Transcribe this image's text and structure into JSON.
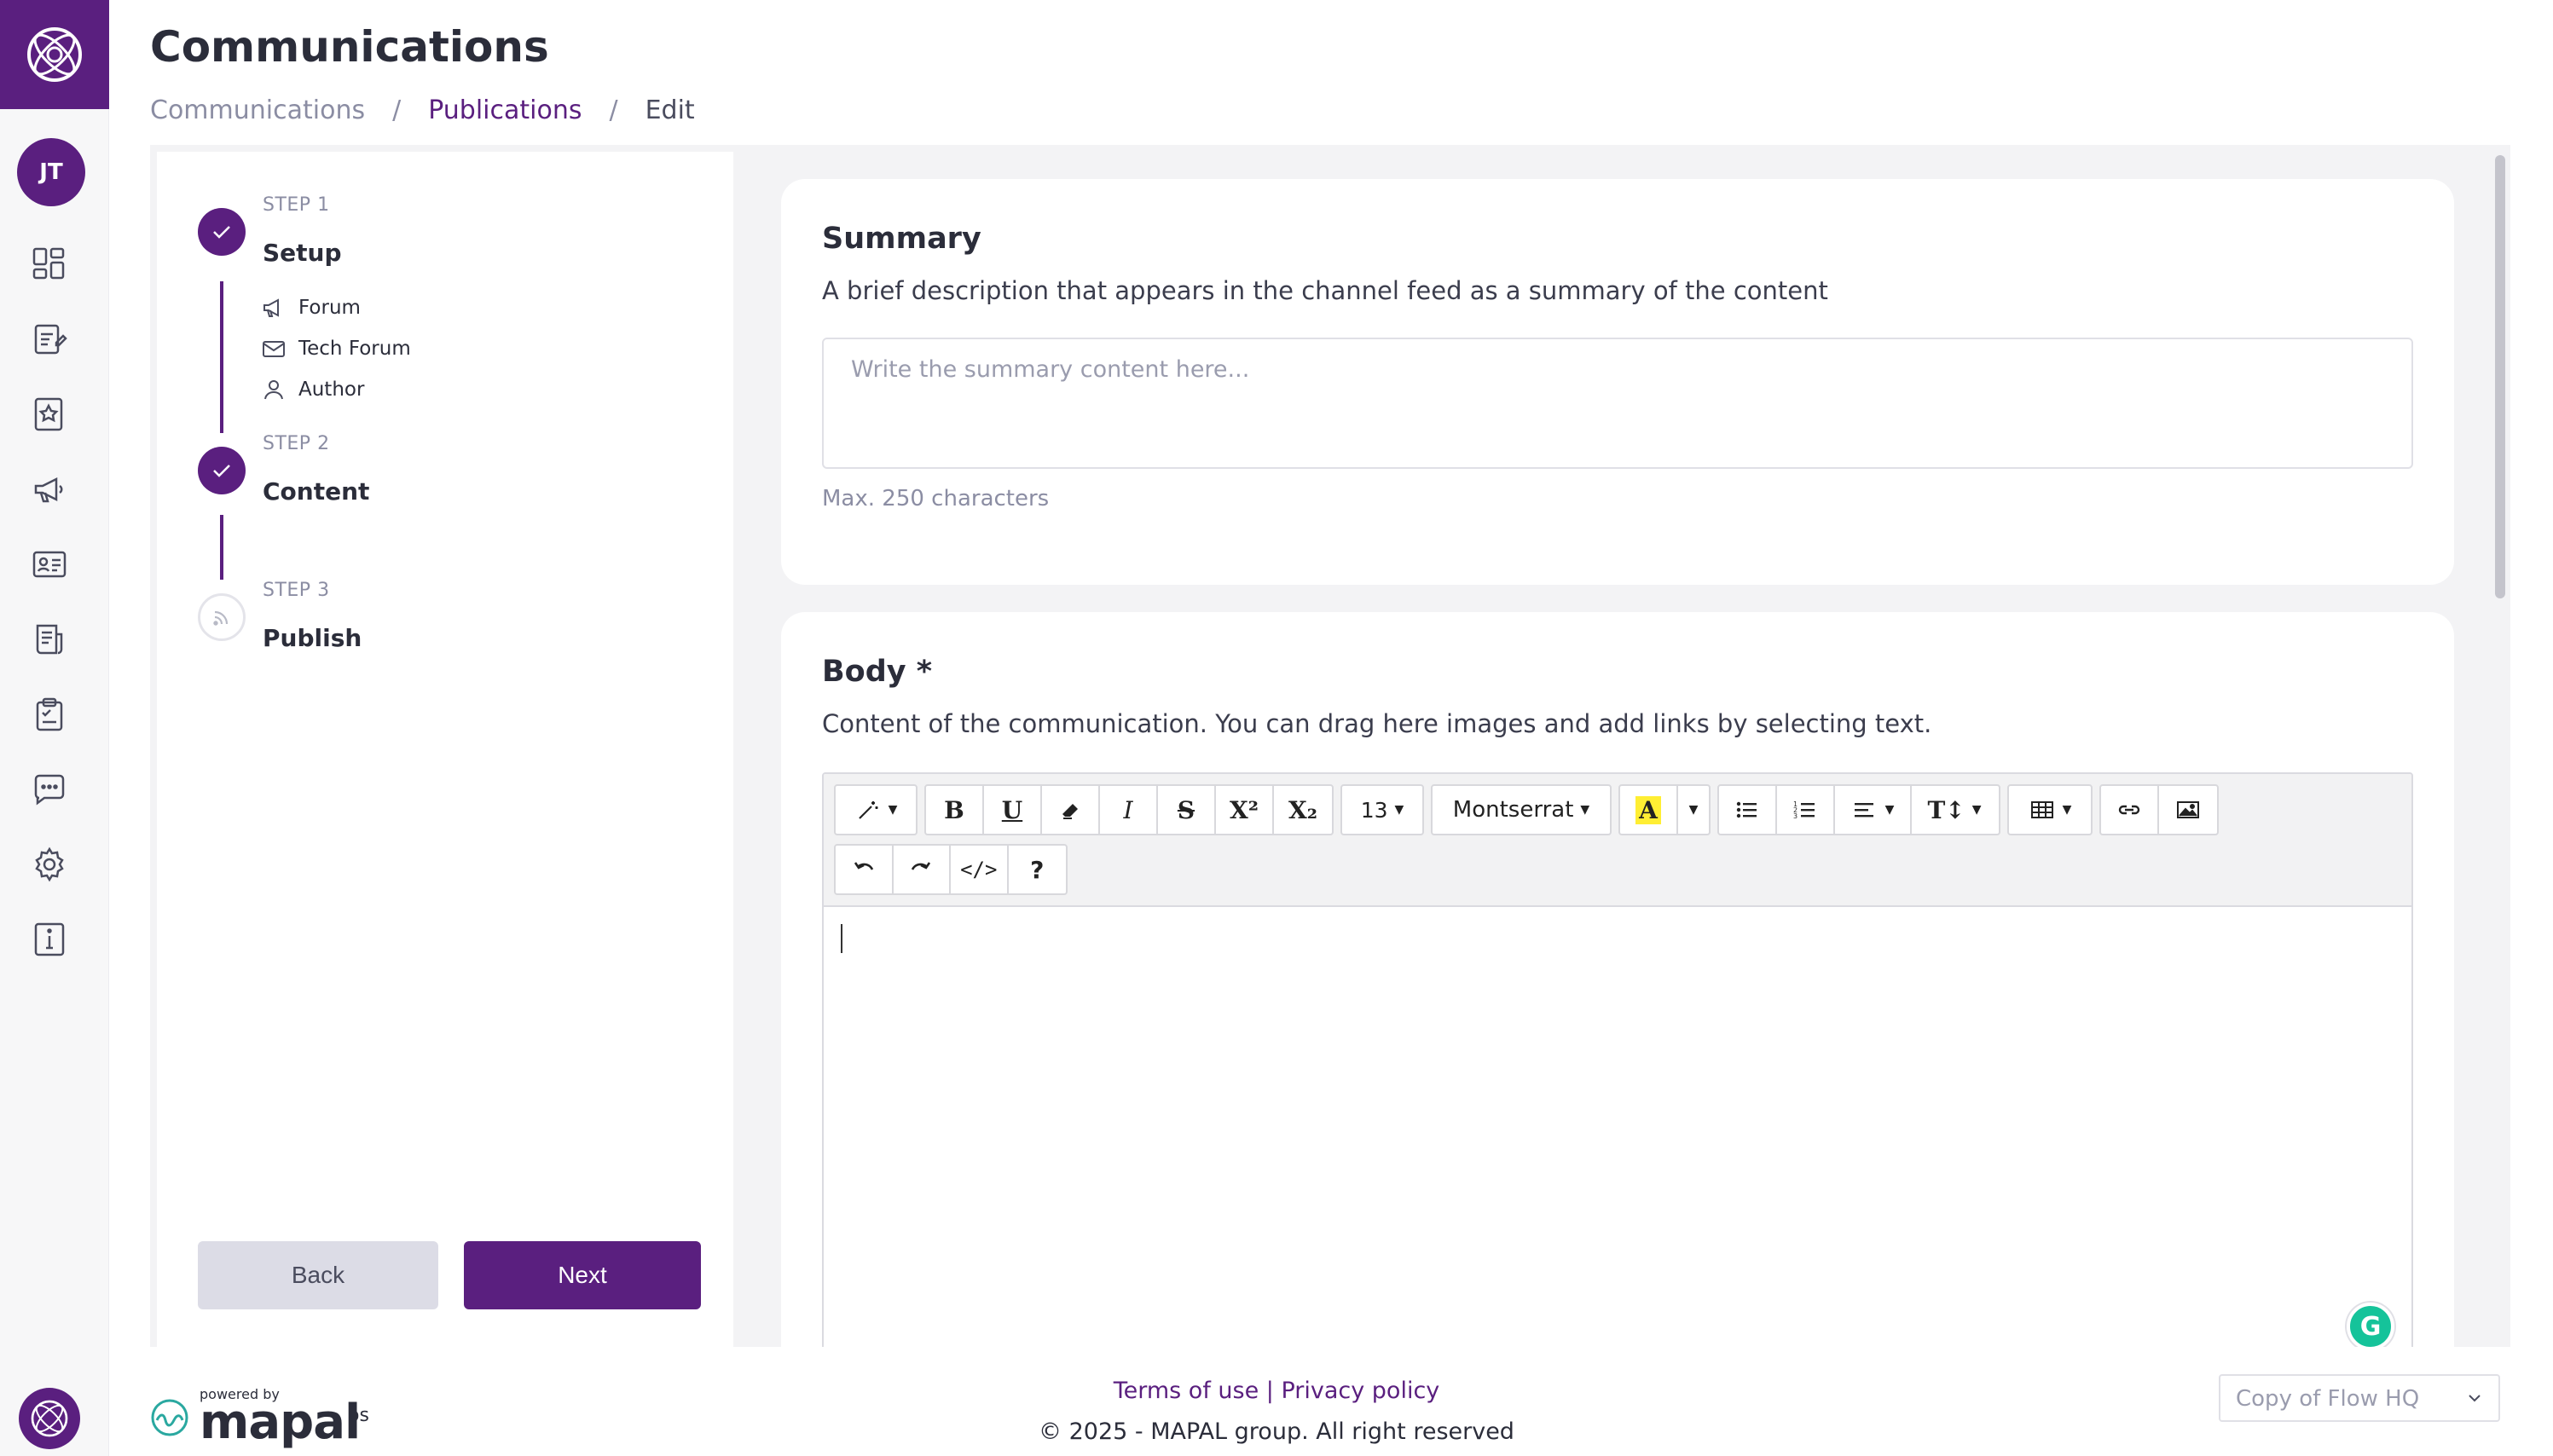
{
  "colors": {
    "brand": "#5a1f7f",
    "background": "#f3f3f5",
    "grammarly": "#15c39a"
  },
  "header": {
    "title": "Communications",
    "breadcrumb": [
      "Communications",
      "Publications",
      "Edit"
    ]
  },
  "sidebar": {
    "user_initials": "JT",
    "icons": [
      "dashboard-icon",
      "edit-document-icon",
      "bookmark-star-icon",
      "megaphone-icon",
      "id-card-icon",
      "newspaper-icon",
      "clipboard-check-icon",
      "chat-bubble-icon",
      "gear-icon",
      "info-icon"
    ]
  },
  "stepper": {
    "step1": {
      "label": "STEP 1",
      "name": "Setup",
      "status": "done",
      "details": [
        "Forum",
        "Tech Forum",
        "Author"
      ]
    },
    "step2": {
      "label": "STEP 2",
      "name": "Content",
      "status": "done"
    },
    "step3": {
      "label": "STEP 3",
      "name": "Publish",
      "status": "pending"
    },
    "back_label": "Back",
    "next_label": "Next"
  },
  "summary": {
    "title": "Summary",
    "description": "A brief description that appears in the channel feed as a summary of the content",
    "placeholder": "Write the summary content here...",
    "hint": "Max. 250 characters"
  },
  "body": {
    "title": "Body *",
    "description": "Content of the communication. You can drag here images and add links by selecting text.",
    "toolbar": {
      "bold": "B",
      "underline": "U",
      "italic": "I",
      "strike": "S",
      "superscript": "X²",
      "subscript": "X₂",
      "font_size": "13",
      "font_family": "Montserrat",
      "highlight": "A",
      "text_size": "T↕",
      "code_view": "</>",
      "help": "?"
    }
  },
  "footer": {
    "powered_by": "powered by",
    "brand": "mapal",
    "brand_suffix": "os",
    "links": "Terms of use | Privacy policy",
    "copyright": "© 2025 - MAPAL group. All right reserved",
    "org_select": "Copy of Flow HQ"
  }
}
